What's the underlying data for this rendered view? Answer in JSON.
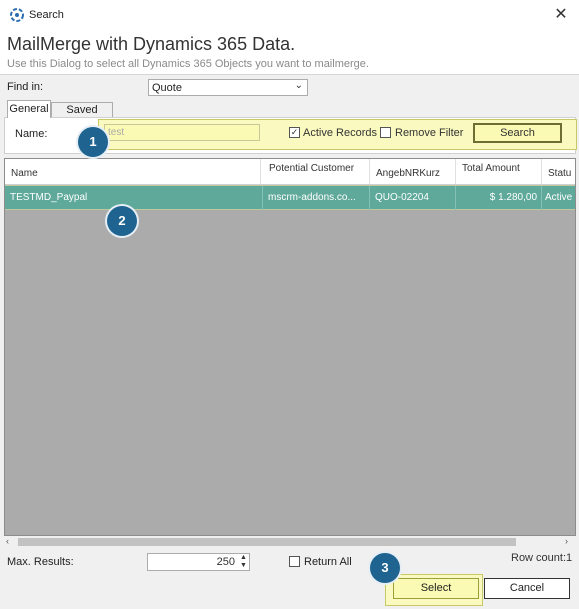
{
  "window": {
    "title": "Search",
    "close_glyph": "✕",
    "icon": "crm-logo-icon"
  },
  "header": {
    "heading": "MailMerge with Dynamics 365 Data.",
    "subheading": "Use this Dialog to select all Dynamics 365 Objects you want to mailmerge."
  },
  "find_in": {
    "label": "Find in:",
    "value": "Quote"
  },
  "tabs": [
    {
      "label": "General",
      "active": true
    },
    {
      "label": "Saved Views",
      "active": false
    }
  ],
  "filter": {
    "name_label": "Name:",
    "name_value": "test",
    "active_records_label": "Active Records",
    "active_records_checked": true,
    "remove_filter_label": "Remove Filter",
    "remove_filter_checked": false,
    "search_label": "Search"
  },
  "grid": {
    "columns": [
      "Name",
      "Potential Customer",
      "AngebNRKurz",
      "Total Amount",
      "Statu"
    ],
    "rows": [
      [
        "TESTMD_Paypal",
        "mscrm-addons.co...",
        "QUO-02204",
        "$ 1.280,00",
        "Active"
      ]
    ]
  },
  "footer": {
    "max_results_label": "Max. Results:",
    "max_results_value": "250",
    "return_all_label": "Return All",
    "return_all_checked": false,
    "row_count": "Row count:1",
    "select_label": "Select",
    "cancel_label": "Cancel"
  },
  "annotations": {
    "badge1": "1",
    "badge2": "2",
    "badge3": "3"
  },
  "colors": {
    "selected_row": "#5ea99a",
    "highlight": "#fafab4",
    "badge": "#1f6491"
  }
}
